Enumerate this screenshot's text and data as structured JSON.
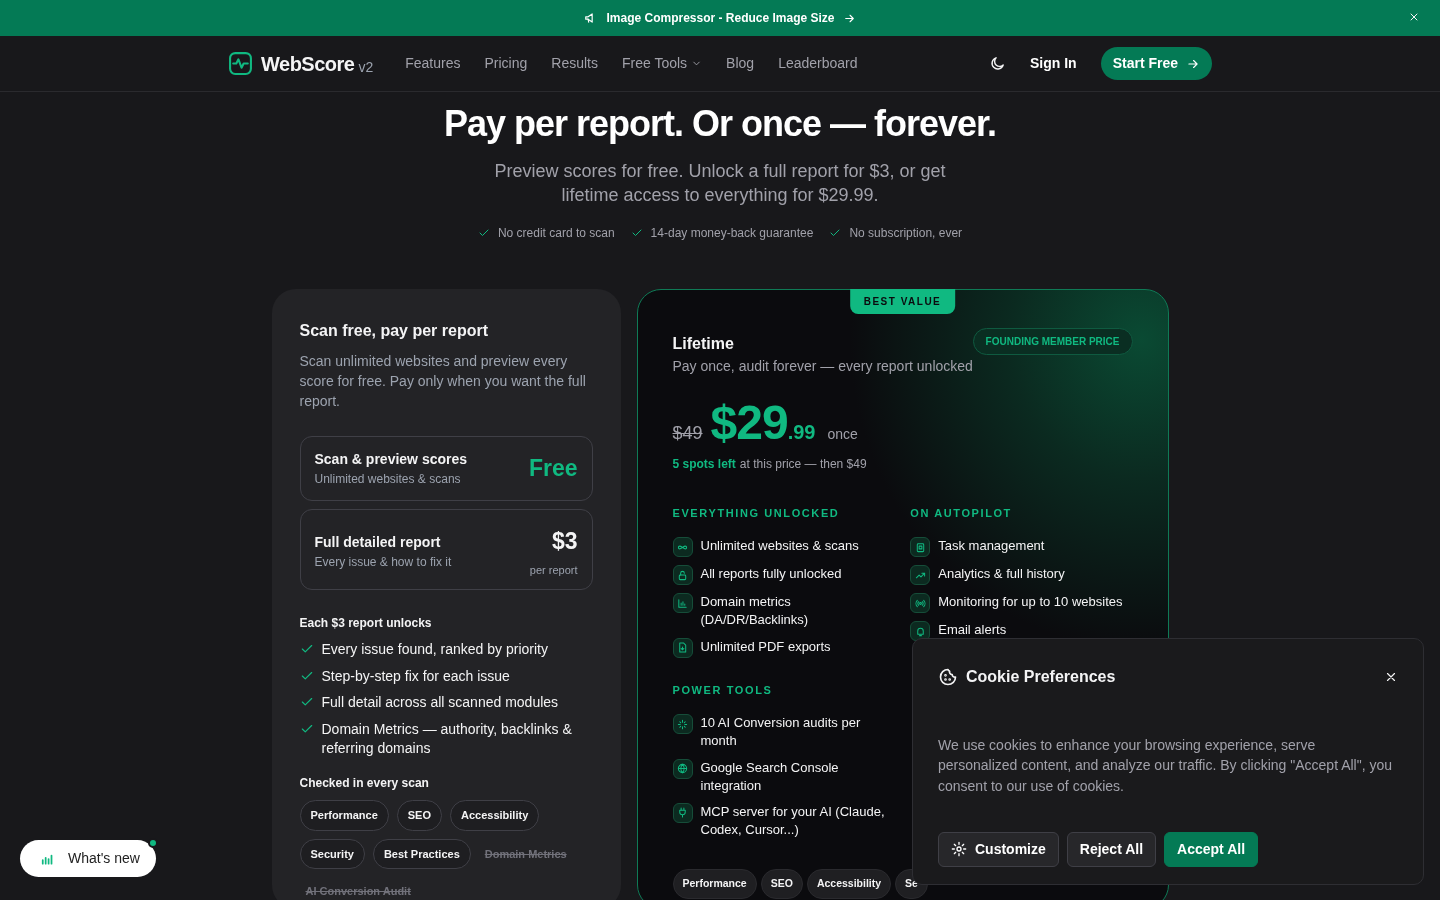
{
  "banner": {
    "text": "Image Compressor - Reduce Image Size"
  },
  "nav": {
    "brand": "WebScore",
    "version": "v2",
    "links": [
      {
        "label": "Features",
        "kind": "link"
      },
      {
        "label": "Pricing",
        "kind": "link"
      },
      {
        "label": "Results",
        "kind": "link"
      },
      {
        "label": "Free Tools",
        "kind": "dropdown"
      },
      {
        "label": "Blog",
        "kind": "link"
      },
      {
        "label": "Leaderboard",
        "kind": "link"
      }
    ],
    "sign_in": "Sign In",
    "cta": "Start Free"
  },
  "hero": {
    "title": "Pay per report. Or once — forever.",
    "subtitle": "Preview scores for free. Unlock a full report for $3, or get lifetime access to everything for $29.99.",
    "checks": [
      "No credit card to scan",
      "14-day money-back guarantee",
      "No subscription, ever"
    ]
  },
  "pay_card": {
    "title": "Scan free, pay per report",
    "description": "Scan unlimited websites and preview every score for free. Pay only when you want the full report.",
    "options": [
      {
        "name": "Scan & preview scores",
        "detail": "Unlimited websites & scans",
        "price": "Free",
        "kind": "free"
      },
      {
        "name": "Full detailed report",
        "detail": "Every issue & how to fix it",
        "price": "$3",
        "note": "per report",
        "kind": "paid"
      }
    ],
    "unlocks_title": "Each $3 report unlocks",
    "unlocks": [
      "Every issue found, ranked by priority",
      "Step-by-step fix for each issue",
      "Full detail across all scanned modules",
      "Domain Metrics — authority, backlinks & referring domains"
    ],
    "checked_title": "Checked in every scan",
    "modules": [
      {
        "label": "Performance",
        "included": true
      },
      {
        "label": "SEO",
        "included": true
      },
      {
        "label": "Accessibility",
        "included": true
      },
      {
        "label": "Security",
        "included": true
      },
      {
        "label": "Best Practices",
        "included": true
      },
      {
        "label": "Domain Metrics",
        "included": false
      },
      {
        "label": "AI Conversion Audit",
        "included": false
      }
    ]
  },
  "lifetime_card": {
    "ribbon": "BEST VALUE",
    "title": "Lifetime",
    "tag": "FOUNDING MEMBER PRICE",
    "description": "Pay once, audit forever — every report unlocked",
    "old_price": "$49",
    "price": "$29",
    "cents": ".99",
    "period": "once",
    "spots": "5 spots left",
    "spots_note": "at this price — then $49",
    "columns": [
      [
        {
          "title": "EVERYTHING UNLOCKED",
          "items": [
            {
              "kind": "infinity",
              "text": "Unlimited websites & scans"
            },
            {
              "kind": "lock",
              "text": "All reports fully unlocked"
            },
            {
              "kind": "chart",
              "text": "Domain metrics (DA/DR/Backlinks)"
            },
            {
              "kind": "file",
              "text": "Unlimited PDF exports"
            }
          ]
        },
        {
          "title": "POWER TOOLS",
          "items": [
            {
              "kind": "sparkle",
              "text": "10 AI Conversion audits per month"
            },
            {
              "kind": "globe",
              "text": "Google Search Console integration"
            },
            {
              "kind": "plug",
              "text": "MCP server for your AI (Claude, Codex, Cursor...)"
            }
          ]
        }
      ],
      [
        {
          "title": "ON AUTOPILOT",
          "items": [
            {
              "kind": "tasks",
              "text": "Task management"
            },
            {
              "kind": "trend",
              "text": "Analytics & full history"
            },
            {
              "kind": "broadcast",
              "text": "Monitoring for up to 10 websites"
            },
            {
              "kind": "bell",
              "text": "Email alerts"
            }
          ]
        }
      ]
    ],
    "modules": [
      "Performance",
      "SEO",
      "Accessibility",
      "Se"
    ]
  },
  "cookie": {
    "title": "Cookie Preferences",
    "text": "We use cookies to enhance your browsing experience, serve personalized content, and analyze our traffic. By clicking \"Accept All\", you consent to our use of cookies.",
    "buttons": [
      {
        "label": "Customize",
        "kind": "settings"
      },
      {
        "label": "Reject All",
        "kind": "secondary"
      },
      {
        "label": "Accept All",
        "kind": "primary"
      }
    ]
  },
  "whats_new": {
    "label": "What's new",
    "unread": true
  }
}
